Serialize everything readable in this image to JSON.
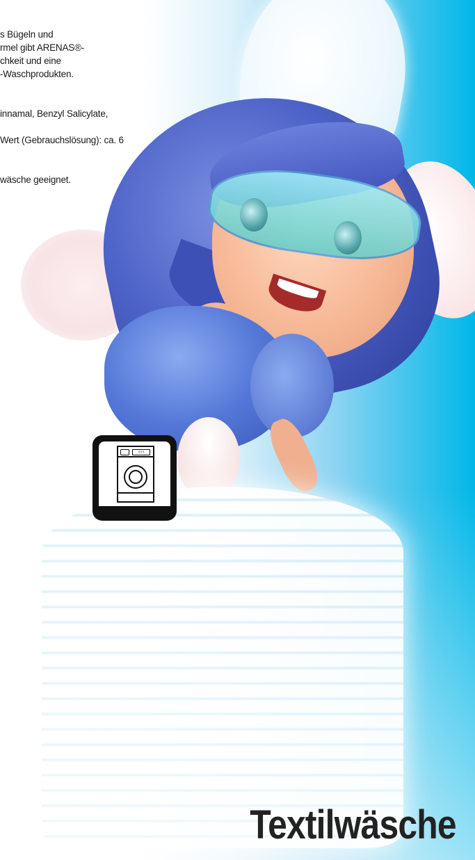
{
  "text_lines": {
    "line1": "s Bügeln und",
    "line2": "rmel gibt ARENAS®-",
    "line3": "chkeit und eine",
    "line4": "-Waschprodukten.",
    "line5": "innamal, Benzyl Salicylate,",
    "line6": "Wert (Gebrauchslösung): ca. 6",
    "line7": "wäsche geeignet."
  },
  "icon": {
    "name": "washing-machine-icon",
    "display_text": "▫▫▫"
  },
  "title": "Textilwäsche",
  "colors": {
    "background_right": "#00b7e8",
    "background_left": "#ffffff",
    "text": "#1a1a1a",
    "title": "#222222",
    "icon": "#111111"
  }
}
